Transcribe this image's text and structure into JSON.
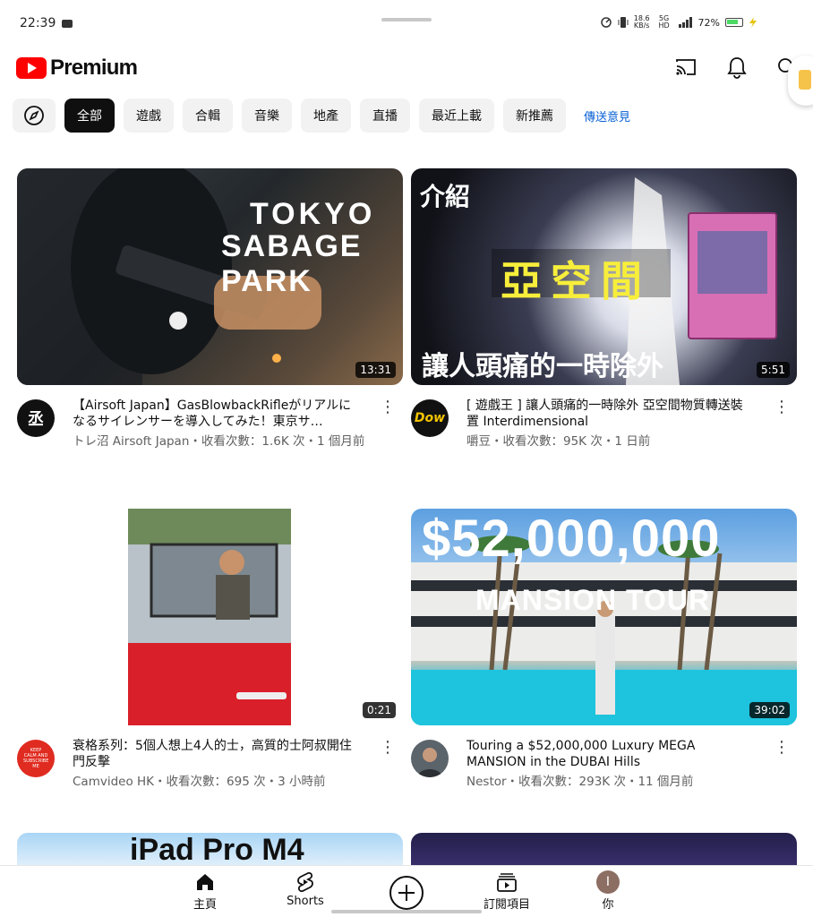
{
  "status_bar": {
    "time": "22:39",
    "speed_value": "18.6",
    "speed_unit": "KB/s",
    "network": "5G HD",
    "battery": "72%"
  },
  "header": {
    "logo_text": "Premium",
    "icons": [
      "cast-icon",
      "bell-icon",
      "search-icon"
    ]
  },
  "chips": [
    "全部",
    "遊戲",
    "合輯",
    "音樂",
    "地產",
    "直播",
    "最近上載",
    "新推薦"
  ],
  "feedback_label": "傳送意見",
  "colors": {
    "accent": "#ff0000",
    "link": "#065fd4",
    "chip_active": "#0f0f0f"
  },
  "videos": [
    {
      "title": "【Airsoft Japan】GasBlowbackRifleがリアルになるサイレンサーを導入してみた！東京サ…",
      "channel_meta": "トレ沼 Airsoft Japan・收看次數：1.6K 次・1 個月前",
      "duration": "13:31",
      "thumb_text": [
        "TOKYO",
        "SABAGE PARK"
      ]
    },
    {
      "title": "[ 遊戲王 ] 讓人頭痛的一時除外 亞空間物質轉送裝置 Interdimensional",
      "channel_meta": "嚼豆・收看次數：95K 次・1 日前",
      "duration": "5:51",
      "avatar_text": "Dow",
      "thumb_text": [
        "介紹",
        "亞空間",
        "讓人頭痛的一時除外"
      ]
    },
    {
      "title": "衰格系列：5個人想上4人的士，高質的士阿叔開住門反擊",
      "channel_meta": "Camvideo HK・收看次數：695 次・3 小時前",
      "duration": "0:21",
      "avatar_text": "KEEP CALM AND SUBSCRIBE ME"
    },
    {
      "title": "Touring a $52,000,000 Luxury MEGA MANSION in the DUBAI Hills",
      "channel_meta": "Nestor・收看次數：293K 次・11 個月前",
      "duration": "39:02",
      "thumb_text": [
        "$52,000,000",
        "MANSION TOUR"
      ]
    }
  ],
  "partial_thumb_text": "iPad Pro M4",
  "bottom_nav": [
    {
      "label": "主頁",
      "icon": "home-icon"
    },
    {
      "label": "Shorts",
      "icon": "shorts-icon"
    },
    {
      "label": "",
      "icon": "create-icon"
    },
    {
      "label": "訂閱項目",
      "icon": "subscriptions-icon"
    },
    {
      "label": "你",
      "icon": "avatar-icon",
      "avatar_letter": "I"
    }
  ]
}
